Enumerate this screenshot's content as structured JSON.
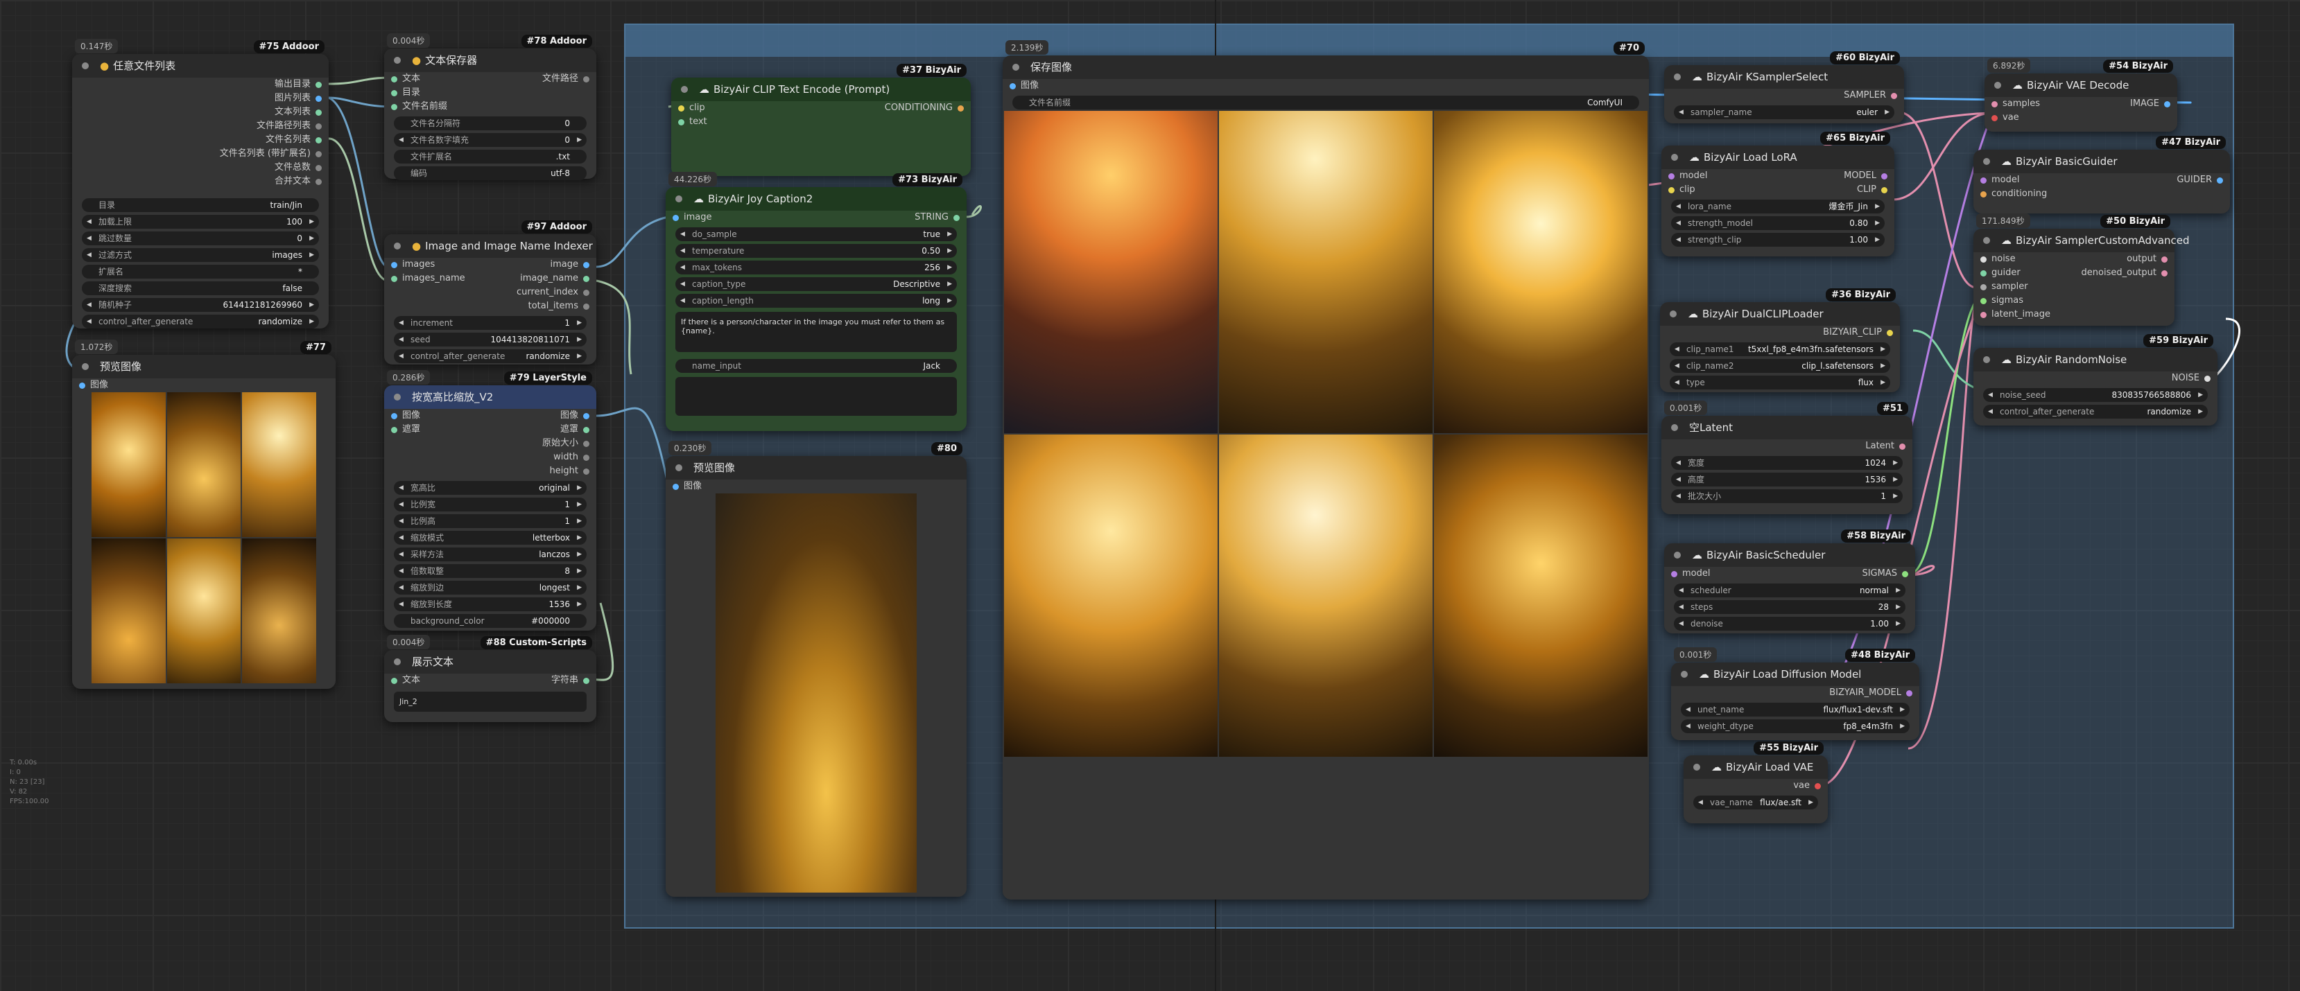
{
  "group": {
    "color": "#4d7598"
  },
  "colors": {
    "node_bg": "#353535",
    "title_bg": "#2a2a2a",
    "green_node": "#2d4a2d",
    "canvas": "#262626"
  },
  "nodes": {
    "n75": {
      "time": "0.147秒",
      "badge": "#75 Addoor",
      "title": "任意文件列表",
      "outputs": [
        "输出目录",
        "图片列表",
        "文本列表",
        "文件路径列表",
        "文件名列表",
        "文件名列表 (带扩展名)",
        "文件总数",
        "合并文本"
      ],
      "widgets": [
        {
          "label": "目录",
          "value": "train/Jin"
        },
        {
          "label": "加载上限",
          "value": "100"
        },
        {
          "label": "跳过数量",
          "value": "0"
        },
        {
          "label": "过滤方式",
          "value": "images"
        },
        {
          "label": "扩展名",
          "value": "*"
        },
        {
          "label": "深度搜索",
          "value": "false"
        },
        {
          "label": "随机种子",
          "value": "614412181269960"
        },
        {
          "label": "control_after_generate",
          "value": "randomize"
        }
      ]
    },
    "n77": {
      "time": "1.072秒",
      "badge": "#77",
      "title": "预览图像",
      "input": "图像"
    },
    "n78": {
      "time": "0.004秒",
      "badge": "#78 Addoor",
      "title": "文本保存器",
      "inputs": [
        "文本",
        "目录",
        "文件名前缀"
      ],
      "output": "文件路径",
      "widgets": [
        {
          "label": "文件名分隔符",
          "value": "0"
        },
        {
          "label": "文件名数字填充",
          "value": "0"
        },
        {
          "label": "文件扩展名",
          "value": ".txt"
        },
        {
          "label": "编码",
          "value": "utf-8"
        }
      ]
    },
    "n97": {
      "badge": "#97 Addoor",
      "title": "Image and Image Name Indexer",
      "inputs": [
        "images",
        "images_name"
      ],
      "outputs": [
        "image",
        "image_name",
        "current_index",
        "total_items"
      ],
      "widgets": [
        {
          "label": "increment",
          "value": "1"
        },
        {
          "label": "seed",
          "value": "104413820811071"
        },
        {
          "label": "control_after_generate",
          "value": "randomize"
        }
      ]
    },
    "n79": {
      "time": "0.286秒",
      "badge": "#79 LayerStyle",
      "title": "按宽高比缩放_V2",
      "inputs": [
        "图像",
        "遮罩"
      ],
      "outputs": [
        "图像",
        "遮罩",
        "原始大小",
        "width",
        "height"
      ],
      "widgets": [
        {
          "label": "宽高比",
          "value": "original"
        },
        {
          "label": "比例宽",
          "value": "1"
        },
        {
          "label": "比例高",
          "value": "1"
        },
        {
          "label": "缩放模式",
          "value": "letterbox"
        },
        {
          "label": "采样方法",
          "value": "lanczos"
        },
        {
          "label": "倍数取整",
          "value": "8"
        },
        {
          "label": "缩放到边",
          "value": "longest"
        },
        {
          "label": "缩放到长度",
          "value": "1536"
        },
        {
          "label": "background_color",
          "value": "#000000"
        }
      ]
    },
    "n88": {
      "time": "0.004秒",
      "badge": "#88 Custom-Scripts",
      "title": "展示文本",
      "input": "文本",
      "output": "字符串",
      "text": "Jin_2"
    },
    "n37": {
      "badge": "#37 BizyAir",
      "title": "BizyAir CLIP Text Encode (Prompt)",
      "inputs": [
        "clip",
        "text"
      ],
      "output": "CONDITIONING"
    },
    "n73": {
      "time": "44.226秒",
      "badge": "#73 BizyAir",
      "title": "BizyAir Joy Caption2",
      "input": "image",
      "output": "STRING",
      "widgets": [
        {
          "label": "do_sample",
          "value": "true"
        },
        {
          "label": "temperature",
          "value": "0.50"
        },
        {
          "label": "max_tokens",
          "value": "256"
        },
        {
          "label": "caption_type",
          "value": "Descriptive"
        },
        {
          "label": "caption_length",
          "value": "long"
        }
      ],
      "prompt": "If there is a person/character in the image you must refer to them as {name}.",
      "name_label": "name_input",
      "name_value": "Jack"
    },
    "n80": {
      "time": "0.230秒",
      "badge": "#80",
      "title": "预览图像",
      "input": "图像"
    },
    "n70": {
      "time": "2.139秒",
      "badge": "#70",
      "title": "保存图像",
      "input": "图像",
      "prefix_label": "文件名前缀",
      "prefix_value": "ComfyUI"
    },
    "n60": {
      "badge": "#60 BizyAir",
      "title": "BizyAir KSamplerSelect",
      "output": "SAMPLER",
      "widget": {
        "label": "sampler_name",
        "value": "euler"
      }
    },
    "n65": {
      "badge": "#65 BizyAir",
      "title": "BizyAir Load LoRA",
      "inputs": [
        "model",
        "clip"
      ],
      "outputs": [
        "MODEL",
        "CLIP"
      ],
      "widgets": [
        {
          "label": "lora_name",
          "value": "爆金币_Jin"
        },
        {
          "label": "strength_model",
          "value": "0.80"
        },
        {
          "label": "strength_clip",
          "value": "1.00"
        }
      ]
    },
    "n36": {
      "badge": "#36 BizyAir",
      "title": "BizyAir DualCLIPLoader",
      "output": "BIZYAIR_CLIP",
      "widgets": [
        {
          "label": "clip_name1",
          "value": "t5xxl_fp8_e4m3fn.safetensors"
        },
        {
          "label": "clip_name2",
          "value": "clip_l.safetensors"
        },
        {
          "label": "type",
          "value": "flux"
        }
      ]
    },
    "n51": {
      "time": "0.001秒",
      "badge": "#51",
      "title": "空Latent",
      "output": "Latent",
      "widgets": [
        {
          "label": "宽度",
          "value": "1024"
        },
        {
          "label": "高度",
          "value": "1536"
        },
        {
          "label": "批次大小",
          "value": "1"
        }
      ]
    },
    "n58": {
      "badge": "#58 BizyAir",
      "title": "BizyAir BasicScheduler",
      "input": "model",
      "output": "SIGMAS",
      "widgets": [
        {
          "label": "scheduler",
          "value": "normal"
        },
        {
          "label": "steps",
          "value": "28"
        },
        {
          "label": "denoise",
          "value": "1.00"
        }
      ]
    },
    "n48": {
      "time": "0.001秒",
      "badge": "#48 BizyAir",
      "title": "BizyAir Load Diffusion Model",
      "output": "BIZYAIR_MODEL",
      "widgets": [
        {
          "label": "unet_name",
          "value": "flux/flux1-dev.sft"
        },
        {
          "label": "weight_dtype",
          "value": "fp8_e4m3fn"
        }
      ]
    },
    "n55": {
      "badge": "#55 BizyAir",
      "title": "BizyAir Load VAE",
      "output": "vae",
      "widget": {
        "label": "vae_name",
        "value": "flux/ae.sft"
      }
    },
    "n54": {
      "time": "6.892秒",
      "badge": "#54 BizyAir",
      "title": "BizyAir VAE Decode",
      "inputs": [
        "samples",
        "vae"
      ],
      "output": "IMAGE"
    },
    "n47": {
      "badge": "#47 BizyAir",
      "title": "BizyAir BasicGuider",
      "inputs": [
        "model",
        "conditioning"
      ],
      "output": "GUIDER"
    },
    "n50": {
      "time": "171.849秒",
      "badge": "#50 BizyAir",
      "title": "BizyAir SamplerCustomAdvanced",
      "inputs": [
        "noise",
        "guider",
        "sampler",
        "sigmas",
        "latent_image"
      ],
      "outputs": [
        "output",
        "denoised_output"
      ]
    },
    "n59": {
      "badge": "#59 BizyAir",
      "title": "BizyAir RandomNoise",
      "output": "NOISE",
      "widgets": [
        {
          "label": "noise_seed",
          "value": "830835766588806"
        },
        {
          "label": "control_after_generate",
          "value": "randomize"
        }
      ]
    }
  },
  "stats": [
    "T: 0.00s",
    "I: 0",
    "N: 23 [23]",
    "V: 82",
    "FPS:100.00"
  ]
}
